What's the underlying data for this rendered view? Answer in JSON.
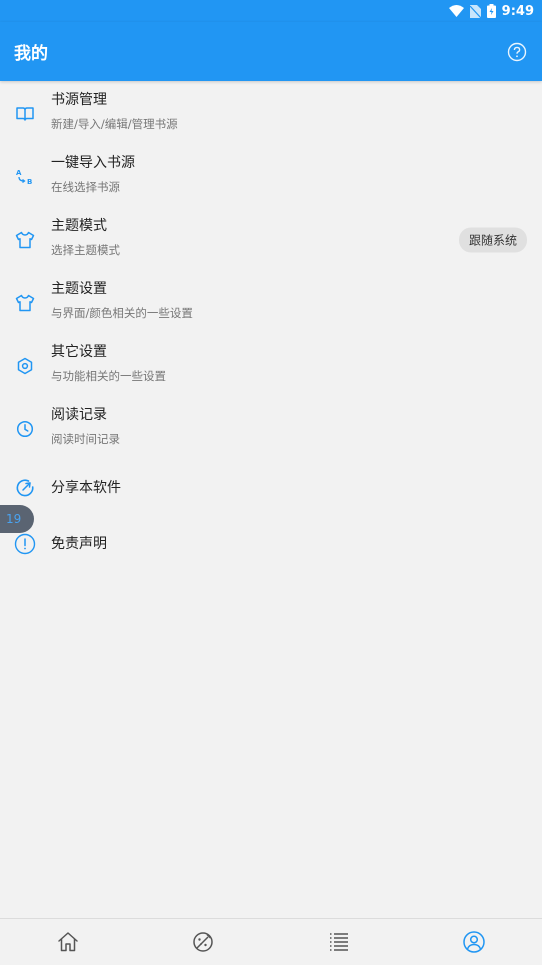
{
  "status_bar": {
    "time": "9:49"
  },
  "app_bar": {
    "title": "我的"
  },
  "menu": [
    {
      "title": "书源管理",
      "subtitle": "新建/导入/编辑/管理书源",
      "icon": "book-icon"
    },
    {
      "title": "一键导入书源",
      "subtitle": "在线选择书源",
      "icon": "translate-icon"
    },
    {
      "title": "主题模式",
      "subtitle": "选择主题模式",
      "icon": "shirt-icon",
      "badge": "跟随系统"
    },
    {
      "title": "主题设置",
      "subtitle": "与界面/颜色相关的一些设置",
      "icon": "shirt-icon"
    },
    {
      "title": "其它设置",
      "subtitle": "与功能相关的一些设置",
      "icon": "gear-icon"
    },
    {
      "title": "阅读记录",
      "subtitle": "阅读时间记录",
      "icon": "clock-icon"
    },
    {
      "title": "分享本软件",
      "icon": "share-icon"
    },
    {
      "title": "免责声明",
      "icon": "info-icon"
    }
  ],
  "float_badge": {
    "text": "19"
  },
  "bottom_nav": [
    "home-icon",
    "discover-icon",
    "list-icon",
    "profile-icon"
  ],
  "colors": {
    "primary": "#2196f3",
    "background": "#f2f2f2",
    "icon_blue": "#2196f3"
  }
}
